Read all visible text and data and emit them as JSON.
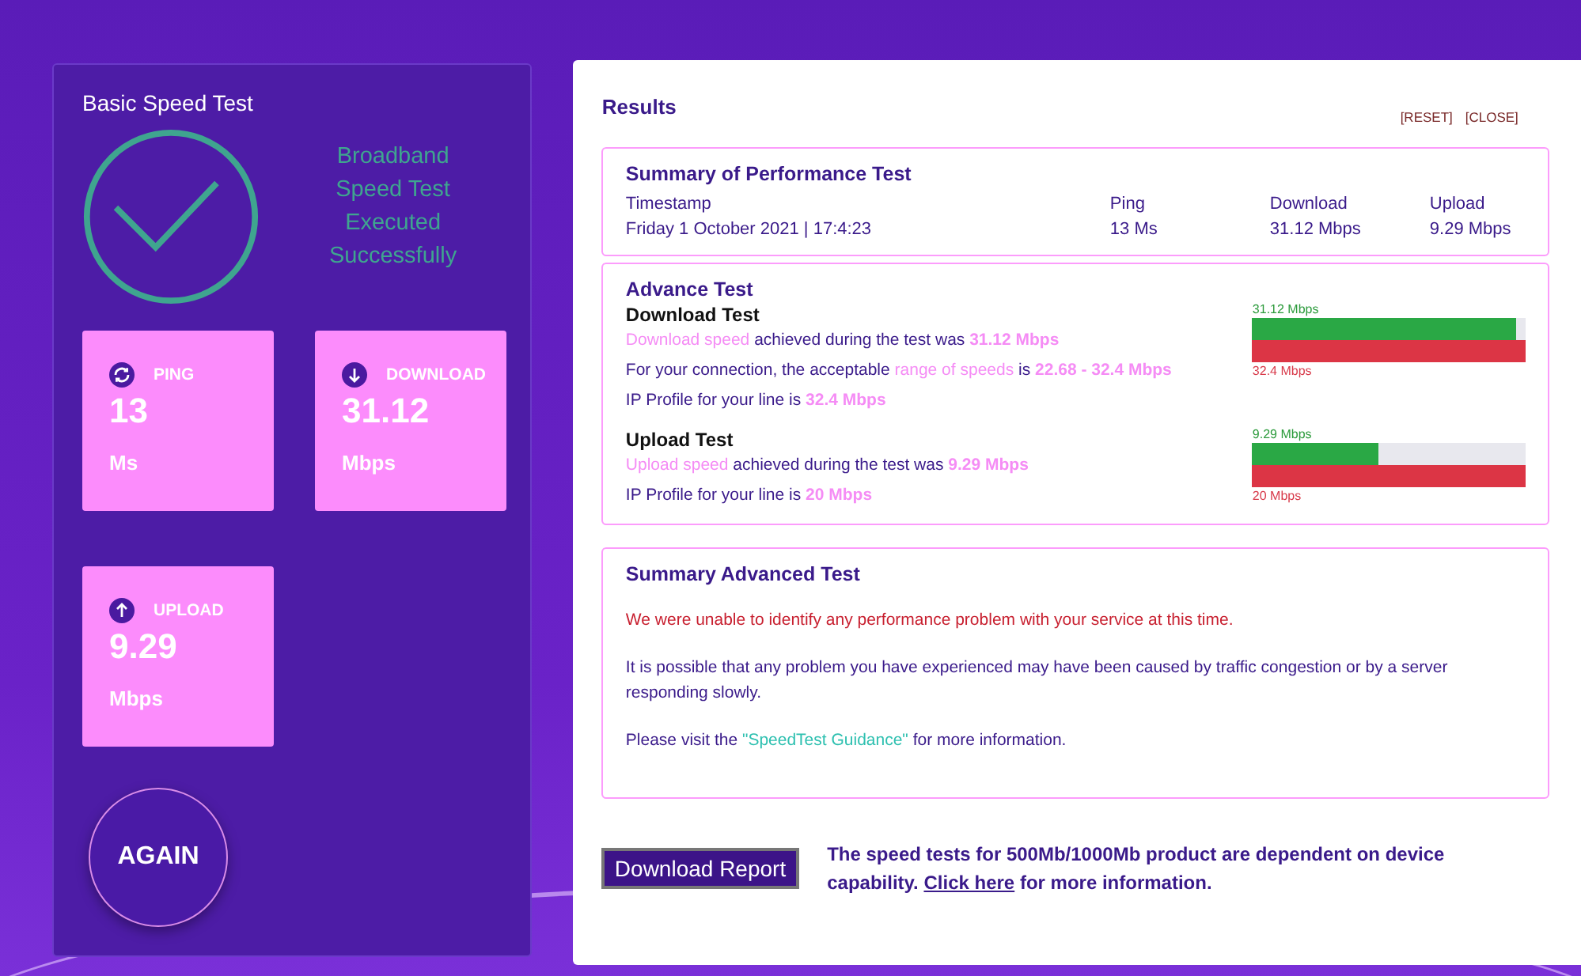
{
  "basic": {
    "title": "Basic Speed Test",
    "status_lines": [
      "Broadband",
      "Speed Test",
      "Executed",
      "Successfully"
    ],
    "tiles": [
      {
        "kind": "ping",
        "label": "PING",
        "value": "13",
        "unit": "Ms"
      },
      {
        "kind": "download",
        "label": "DOWNLOAD",
        "value": "31.12",
        "unit": "Mbps"
      },
      {
        "kind": "upload",
        "label": "UPLOAD",
        "value": "9.29",
        "unit": "Mbps"
      }
    ],
    "again_button": "AGAIN"
  },
  "results": {
    "title": "Results",
    "actions": [
      "[RESET]",
      "[CLOSE]"
    ],
    "summary": {
      "title": "Summary of Performance Test",
      "columns": [
        {
          "label": "Timestamp",
          "value": "Friday 1 October 2021 | 17:4:23"
        },
        {
          "label": "Ping",
          "value": "13 Ms"
        },
        {
          "label": "Download",
          "value": "31.12 Mbps"
        },
        {
          "label": "Upload",
          "value": "9.29 Mbps"
        }
      ]
    },
    "advance": {
      "title": "Advance Test",
      "tests": [
        {
          "title": "Download Test",
          "lines": [
            [
              {
                "kind": "highlight",
                "text": "Download speed"
              },
              {
                "kind": "plain",
                "text": " achieved during the test was "
              },
              {
                "kind": "value",
                "text": "31.12 Mbps"
              }
            ],
            [
              {
                "kind": "plain",
                "text": "For your connection, the acceptable "
              },
              {
                "kind": "highlight",
                "text": "range of speeds"
              },
              {
                "kind": "plain",
                "text": " is "
              },
              {
                "kind": "value",
                "text": "22.68 - 32.4 Mbps"
              }
            ],
            [
              {
                "kind": "plain",
                "text": "IP Profile for your line is "
              },
              {
                "kind": "value",
                "text": "32.4 Mbps"
              }
            ]
          ],
          "speed_label": "31.12 Mbps",
          "level": 0.96,
          "profile_label": "32.4 Mbps"
        },
        {
          "title": "Upload Test",
          "lines": [
            [
              {
                "kind": "highlight",
                "text": "Upload speed"
              },
              {
                "kind": "plain",
                "text": " achieved during the test was "
              },
              {
                "kind": "value",
                "text": "9.29 Mbps"
              }
            ],
            [
              {
                "kind": "plain",
                "text": "IP Profile for your line is "
              },
              {
                "kind": "value",
                "text": "20 Mbps"
              }
            ]
          ],
          "speed_label": "9.29 Mbps",
          "level": 0.46,
          "profile_label": "20 Mbps"
        }
      ]
    },
    "summary_advanced": {
      "title": "Summary Advanced Test",
      "paragraphs": [
        {
          "kind": "alert",
          "parts": [
            {
              "kind": "plain",
              "text": "We were unable to identify any performance problem with your service at this time."
            }
          ]
        },
        {
          "kind": "plain",
          "parts": [
            {
              "kind": "plain",
              "text": "It is possible that any problem you have experienced may have been caused by traffic congestion or by a server responding slowly."
            }
          ]
        },
        {
          "kind": "plain",
          "parts": [
            {
              "kind": "plain",
              "text": "Please visit the "
            },
            {
              "kind": "link",
              "text": "\"SpeedTest Guidance\""
            },
            {
              "kind": "plain",
              "text": " for more information."
            }
          ]
        }
      ]
    },
    "download_report_button": "Download Report",
    "note": [
      {
        "kind": "plain",
        "text": "The speed tests for 500Mb/1000Mb product are dependent on device capability. "
      },
      {
        "kind": "link",
        "text": "Click here"
      },
      {
        "kind": "plain",
        "text": " for more information."
      }
    ]
  }
}
